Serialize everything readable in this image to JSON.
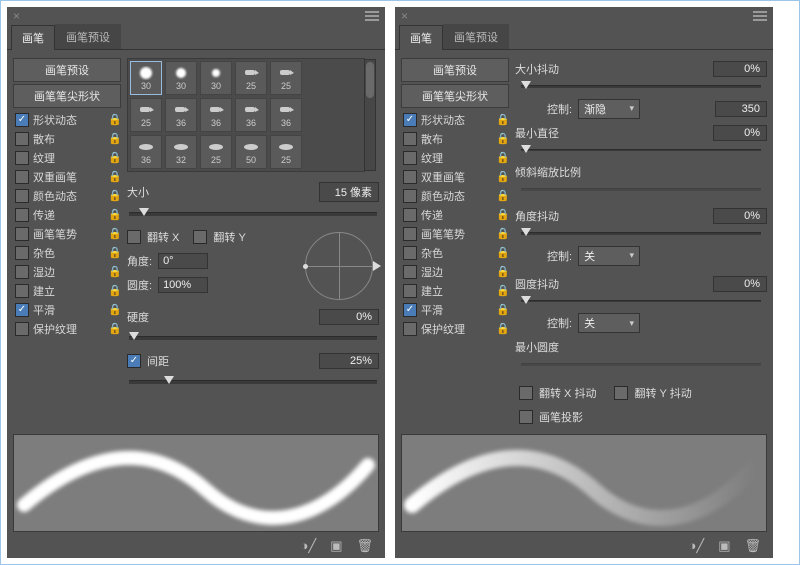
{
  "tabs": {
    "brush": "画笔",
    "presets": "画笔预设"
  },
  "side": {
    "preset_btn": "画笔预设",
    "tip_btn": "画笔笔尖形状",
    "items": [
      {
        "label": "形状动态",
        "checked": true
      },
      {
        "label": "散布",
        "checked": false
      },
      {
        "label": "纹理",
        "checked": false
      },
      {
        "label": "双重画笔",
        "checked": false
      },
      {
        "label": "颜色动态",
        "checked": false
      },
      {
        "label": "传递",
        "checked": false
      },
      {
        "label": "画笔笔势",
        "checked": false
      },
      {
        "label": "杂色",
        "checked": false
      },
      {
        "label": "湿边",
        "checked": false
      },
      {
        "label": "建立",
        "checked": false
      },
      {
        "label": "平滑",
        "checked": true
      },
      {
        "label": "保护纹理",
        "checked": false
      }
    ]
  },
  "leftPanel": {
    "brush_sizes": [
      "30",
      "30",
      "30",
      "25",
      "25",
      "25",
      "36",
      "36",
      "36",
      "36",
      "36",
      "32",
      "25",
      "50",
      "25"
    ],
    "sel_index": 0,
    "size_label": "大小",
    "size_value": "15 像素",
    "flip_x": "翻转 X",
    "flip_y": "翻转 Y",
    "angle_label": "角度:",
    "angle_value": "0°",
    "round_label": "圆度:",
    "round_value": "100%",
    "hard_label": "硬度",
    "hard_value": "0%",
    "spacing_label": "间距",
    "spacing_value": "25%"
  },
  "rightPanel": {
    "size_jitter": "大小抖动",
    "size_jitter_val": "0%",
    "control": "控制:",
    "control1_sel": "渐隐",
    "control1_val": "350",
    "min_diam": "最小直径",
    "min_diam_val": "0%",
    "tilt_scale": "倾斜缩放比例",
    "angle_jitter": "角度抖动",
    "angle_jitter_val": "0%",
    "control2_sel": "关",
    "round_jitter": "圆度抖动",
    "round_jitter_val": "0%",
    "control3_sel": "关",
    "min_round": "最小圆度",
    "flip_x_jitter": "翻转 X 抖动",
    "flip_y_jitter": "翻转 Y 抖动",
    "brush_proj": "画笔投影"
  },
  "icons": {
    "close": "×",
    "lock": "🔒"
  }
}
